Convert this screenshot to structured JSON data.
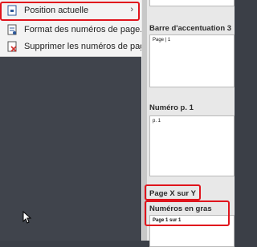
{
  "menu": {
    "items": [
      {
        "label": "Position actuelle",
        "icon": "page-position-icon",
        "submenu": "›"
      },
      {
        "label": "Format des numéros de page...",
        "icon": "format-page-numbers-icon"
      },
      {
        "label": "Supprimer les numéros de page",
        "icon": "remove-page-numbers-icon"
      }
    ]
  },
  "gallery": {
    "sections": [
      {
        "title": "Barre d'accentuation 3",
        "preview": "Page | 1"
      },
      {
        "title": "Numéro p. 1",
        "preview": "p. 1"
      },
      {
        "title": "Page X sur Y",
        "preview": ""
      },
      {
        "title": "Numéros en gras",
        "preview": "Page 1 sur 1"
      }
    ]
  },
  "colors": {
    "highlight": "#e0141c",
    "dark_bg": "#40444c"
  }
}
